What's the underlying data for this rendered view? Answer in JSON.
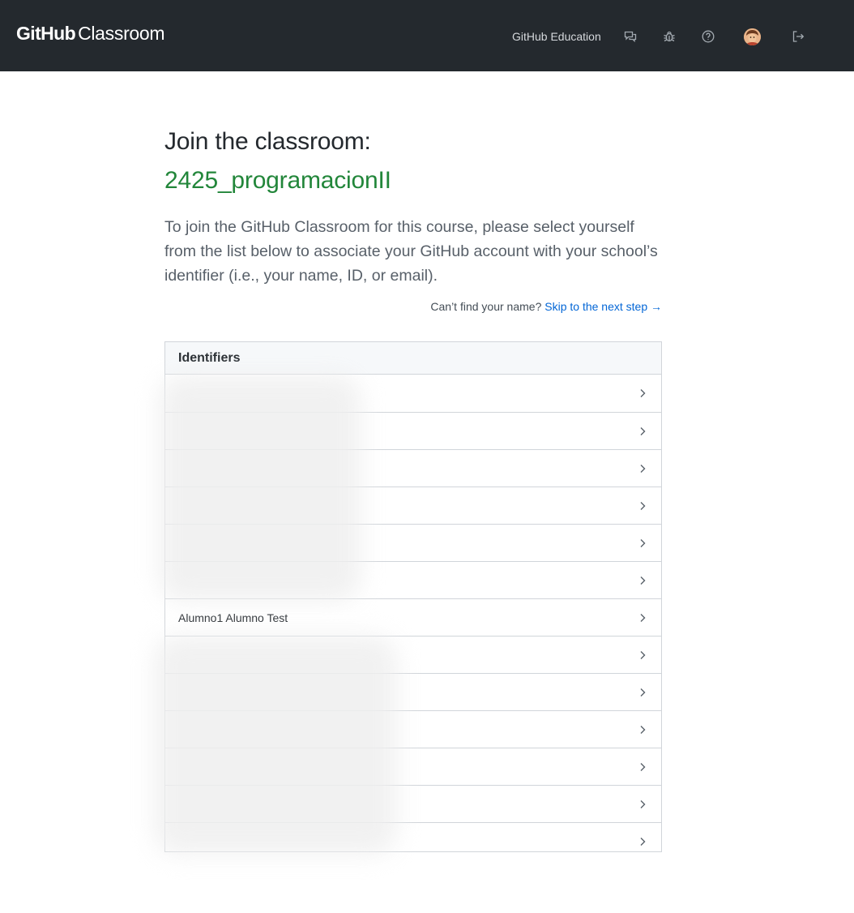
{
  "header": {
    "brand_bold": "GitHub",
    "brand_light": "Classroom",
    "education_link": "GitHub Education",
    "icons": [
      "feedback-icon",
      "bug-icon",
      "help-icon",
      "avatar",
      "sign-out-icon"
    ]
  },
  "main": {
    "title": "Join the classroom:",
    "classroom_name": "2425_programacionII",
    "intro": "To join the GitHub Classroom for this course, please select yourself from the list below to associate your GitHub account with your school’s identifier (i.e., your name, ID, or email).",
    "cant_find": "Can’t find your name?",
    "skip_link": "Skip to the next step →"
  },
  "identifiers": {
    "header": "Identifiers",
    "rows": [
      "",
      "",
      "",
      "",
      "",
      "",
      "Alumno1 Alumno Test",
      "",
      "",
      "",
      "",
      "",
      ""
    ]
  },
  "colors": {
    "topbar": "#24292e",
    "classroom_name": "#22863a",
    "link": "#0366d6"
  }
}
